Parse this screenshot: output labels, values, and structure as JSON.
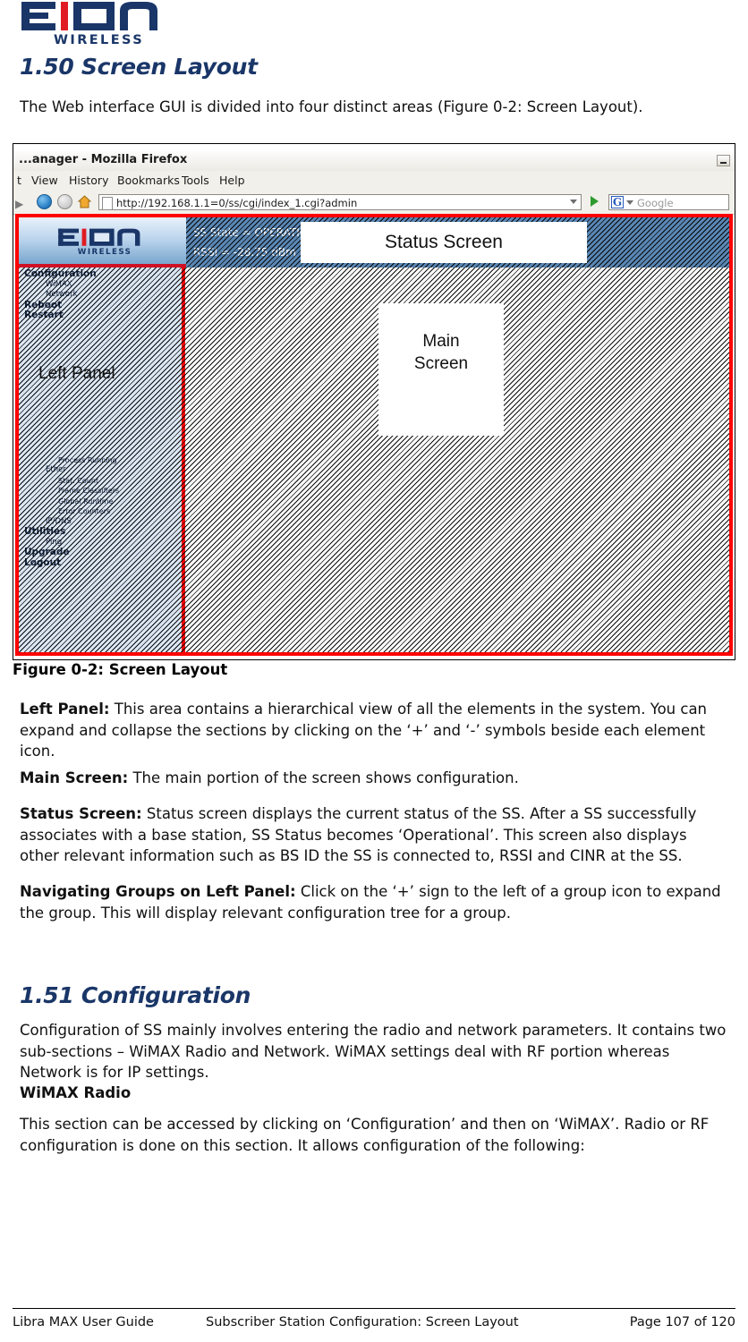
{
  "brand": {
    "name": "EION",
    "sub": "WIRELESS",
    "navy": "#1a3668",
    "red": "#e01b24"
  },
  "section_1_50": {
    "heading": "1.50 Screen Layout",
    "intro": "The Web interface GUI is divided into four distinct areas (Figure 0-2: Screen Layout)."
  },
  "figure": {
    "caption": "Figure 0-2: Screen Layout",
    "browser": {
      "title": "...anager - Mozilla Firefox",
      "minimize_label": "_",
      "menu": [
        "t",
        "View",
        "History",
        "Bookmarks",
        "Tools",
        "Help"
      ],
      "url": "http://192.168.1.1=0/ss/cgi/index_1.cgi?admin",
      "search_placeholder": "Google",
      "search_engine_letter": "G"
    },
    "app": {
      "status_lines": [
        "SS State = OPERATIONAL",
        "RSSI = -28.75 dBm"
      ],
      "tree": [
        {
          "label": "Configuration",
          "level": 0
        },
        {
          "label": "WiMAX",
          "level": 1
        },
        {
          "label": "Network",
          "level": 1
        },
        {
          "label": "Reboot",
          "level": 0
        },
        {
          "label": "Restart",
          "level": 0
        },
        {
          "label": "Process Running",
          "level": 2
        },
        {
          "label": "Ether",
          "level": 1
        },
        {
          "label": "Stat. Count",
          "level": 2
        },
        {
          "label": "Frame Classifiers",
          "level": 2
        },
        {
          "label": "Global Runtime",
          "level": 2
        },
        {
          "label": "Error Counters",
          "level": 2
        },
        {
          "label": "IP/DNS",
          "level": 1
        },
        {
          "label": "Utilities",
          "level": 0
        },
        {
          "label": "Ping",
          "level": 1
        },
        {
          "label": "Upgrade",
          "level": 0
        },
        {
          "label": "Logout",
          "level": 0
        }
      ]
    },
    "callouts": {
      "status_screen": "Status Screen",
      "left_panel": "Left Panel",
      "main_screen_line1": "Main",
      "main_screen_line2": "Screen"
    }
  },
  "descriptions": {
    "left_panel_label": "Left Panel:",
    "left_panel_text": " This area contains a hierarchical view of all the elements in the system. You can expand and collapse the sections by clicking on the ‘+’ and ‘-’ symbols beside each element icon.",
    "main_screen_label": "Main Screen:",
    "main_screen_text": " The main portion of the screen shows configuration.",
    "status_screen_label": "Status Screen:",
    "status_screen_text": " Status screen displays the current status of the SS. After a SS successfully associates with a base station, SS Status becomes ‘Operational’. This screen also displays other relevant information such as BS ID the SS is connected to, RSSI  and CINR at the SS.",
    "navigating_label": "Navigating Groups on Left Panel:",
    "navigating_text": " Click on the ‘+’ sign to the left of a group icon to expand the group. This will display relevant configuration tree for a group."
  },
  "section_1_51": {
    "heading": "1.51 Configuration",
    "intro": "Configuration of SS mainly involves entering the radio and network parameters. It contains two sub-sections – WiMAX Radio and Network. WiMAX settings deal with RF portion whereas Network is for IP settings.",
    "subheading": "WiMAX Radio",
    "body": "This section can be accessed by clicking on ‘Configuration’ and then on ‘WiMAX’. Radio or RF configuration is done on this section. It allows configuration of the following:"
  },
  "footer": {
    "left": "Libra MAX User Guide",
    "center": "Subscriber Station Configuration: Screen Layout",
    "right": "Page 107 of 120"
  }
}
